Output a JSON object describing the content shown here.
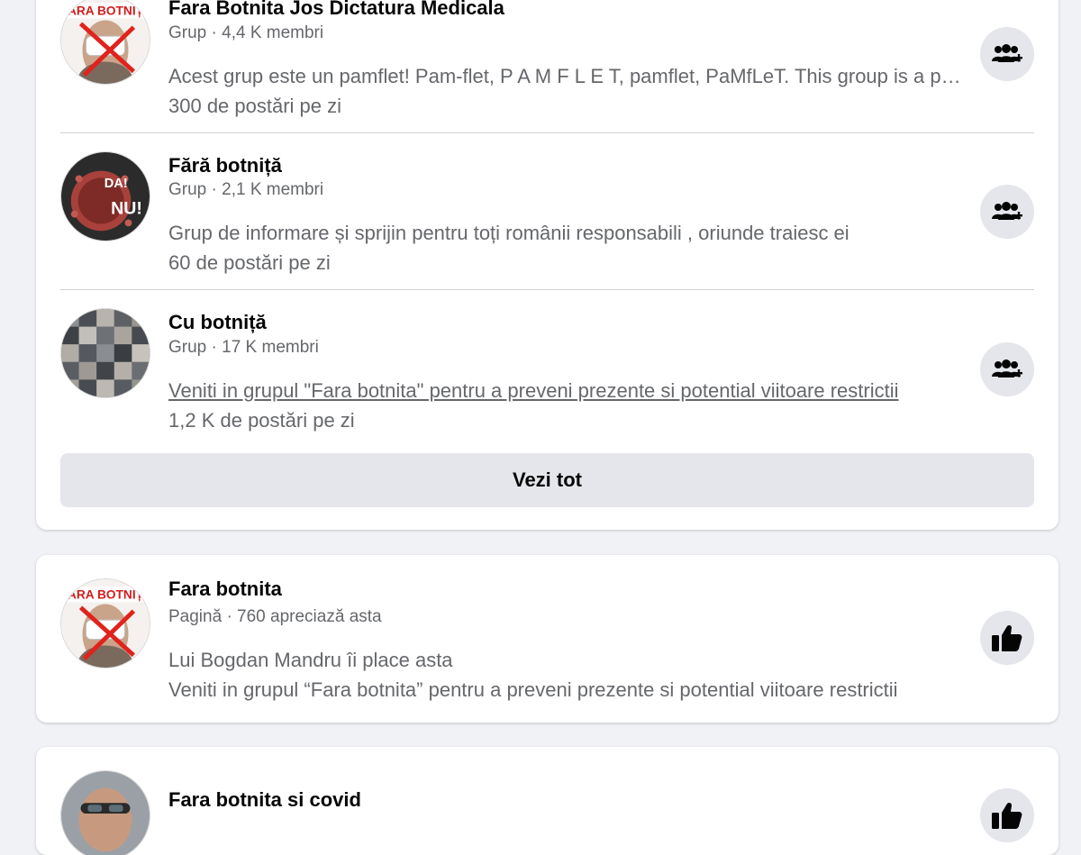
{
  "groups_card": {
    "results": [
      {
        "title": "Fara Botnita Jos Dictatura Medicala",
        "meta": "Grup · 4,4 K membri",
        "description": "Acest grup este un pamflet! Pam-flet, P A M F L E T, pamflet, PaMfLeT. This group is a pamphlet!",
        "activity": "300 de postări pe zi",
        "avatar_text": "ARA BOTNIȚ",
        "action_icon": "join-group-icon"
      },
      {
        "title": "Fără botniță",
        "meta": "Grup · 2,1 K membri",
        "description": "Grup de informare și sprijin pentru toți românii responsabili , oriunde traiesc ei",
        "activity": "60 de postări pe zi",
        "avatar_text_1": "DA!",
        "avatar_text_2": "NU!",
        "action_icon": "join-group-icon"
      },
      {
        "title": "Cu botniță",
        "meta": "Grup · 17 K membri",
        "description": "Veniti in grupul \"Fara botnita\" pentru a preveni prezente si potential viitoare restrictii",
        "activity": "1,2 K de postări pe zi",
        "action_icon": "join-group-icon"
      }
    ],
    "see_all_label": "Vezi tot"
  },
  "page_card": {
    "title": "Fara botnita",
    "meta": "Pagină · 760 apreciază asta",
    "social": "Lui Bogdan Mandru îi place asta",
    "description": "Veniti in grupul “Fara botnita” pentru a preveni prezente si potential viitoare restrictii",
    "avatar_text": "ARA BOTNIȚ",
    "action_icon": "like-icon"
  },
  "third_card": {
    "title": "Fara botnita si covid",
    "action_icon": "like-icon"
  }
}
